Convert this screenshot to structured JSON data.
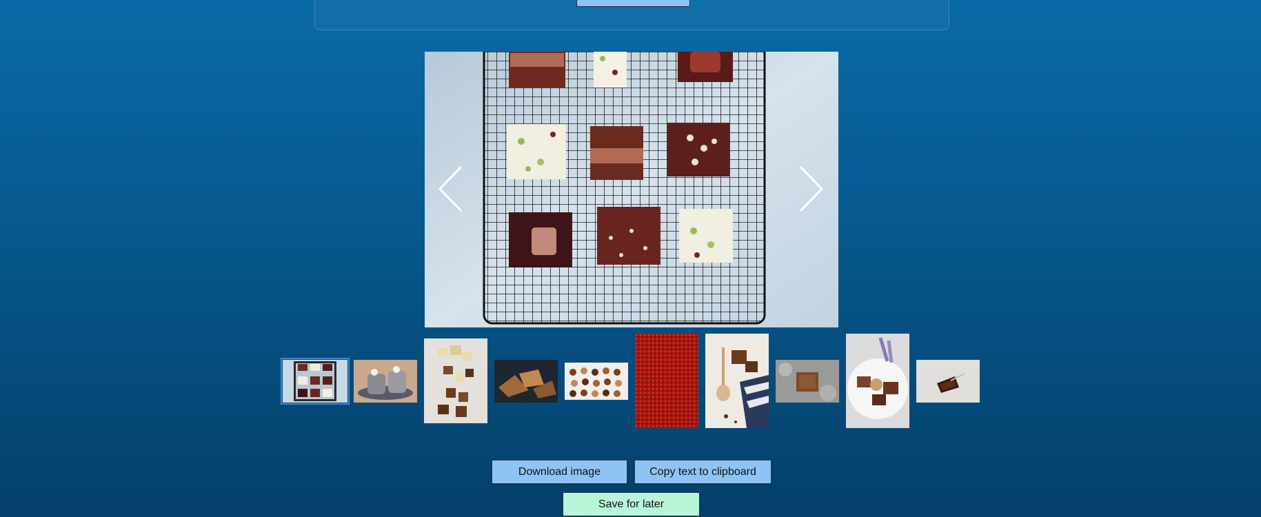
{
  "top_panel": {
    "button_label": ""
  },
  "viewer": {
    "image_icon": "chocolate-fudge-squares-on-cooling-rack",
    "prev_icon": "chevron-left-icon",
    "next_icon": "chevron-right-icon"
  },
  "thumbnails": [
    {
      "icon": "fudge-squares-rack",
      "selected": true
    },
    {
      "icon": "hot-chocolate-mugs",
      "selected": false
    },
    {
      "icon": "chocolate-bar-pieces",
      "selected": false
    },
    {
      "icon": "chocolate-shards-dark",
      "selected": false
    },
    {
      "icon": "chocolate-truffles-grid",
      "selected": false
    },
    {
      "icon": "red-texture",
      "selected": false
    },
    {
      "icon": "chocolate-spoon-napkin",
      "selected": false
    },
    {
      "icon": "chocolate-on-marble",
      "selected": false
    },
    {
      "icon": "chocolate-lavender-plate",
      "selected": false
    },
    {
      "icon": "chocolate-piece-white",
      "selected": false
    }
  ],
  "actions": {
    "download_label": "Download image",
    "copy_label": "Copy text to clipboard",
    "save_label": "Save for later"
  },
  "colors": {
    "background_top": "#0a6aa7",
    "background_bottom": "#04406b",
    "button_blue": "#8ec4f5",
    "button_green": "#b6f5d8"
  }
}
